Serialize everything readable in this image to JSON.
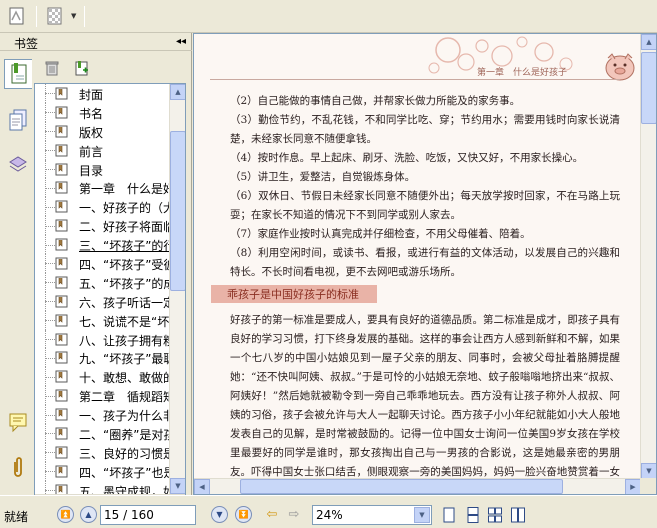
{
  "sidebar": {
    "title": "书签",
    "collapse_glyph": "◂◂",
    "bookmarks": [
      {
        "label": "封面"
      },
      {
        "label": "书名"
      },
      {
        "label": "版权"
      },
      {
        "label": "前言"
      },
      {
        "label": "目录"
      },
      {
        "label": "第一章　什么是好"
      },
      {
        "label": "一、好孩子的（大"
      },
      {
        "label": "二、好孩子将面临"
      },
      {
        "label": "三、“坏孩子”的行"
      },
      {
        "label": "四、“坏孩子”受彼"
      },
      {
        "label": "五、“坏孩子”的成"
      },
      {
        "label": "六、孩子听话一定"
      },
      {
        "label": "七、说谎不是“坏"
      },
      {
        "label": "八、让孩子拥有糗"
      },
      {
        "label": "九、“坏孩子”最聪"
      },
      {
        "label": "十、敢想、敢做的"
      },
      {
        "label": "第二章　循规蹈矩"
      },
      {
        "label": "一、孩子为什么非"
      },
      {
        "label": "二、“圈养”是对孩"
      },
      {
        "label": "三、良好的习惯是"
      },
      {
        "label": "四、“坏孩子”也是"
      },
      {
        "label": "五、墨守成规，如"
      }
    ],
    "selected_index": 8,
    "scroll_position": 0.14
  },
  "document": {
    "header_text": "第一章　什么是好孩子",
    "paragraphs": [
      "（2）自己能做的事情自己做，并帮家长做力所能及的家务事。",
      "（3）勤俭节约，不乱花钱，不和同学比吃、穿；节约用水；需要用钱时向家长说清楚，未经家长同意不随便拿钱。",
      "（4）按时作息。早上起床、刷牙、洗脸、吃饭，又快又好，不用家长操心。",
      "（5）讲卫生，爱整洁，自觉锻炼身体。",
      "（6）双休日、节假日未经家长同意不随便外出；每天放学按时回家，不在马路上玩耍；在家长不知道的情况下不到同学或别人家去。",
      "（7）家庭作业按时认真完成并仔细检查，不用父母催着、陪着。",
      "（8）利用空闲时间，或读书、看报，或进行有益的文体活动，以发展自己的兴趣和特长。不长时间看电视，更不去网吧或游乐场所。"
    ],
    "section_title": "乖孩子是中国好孩子的标准",
    "body": "好孩子的第一标准是要成人，要具有良好的道德品质。第二标准是成才，即孩子具有良好的学习习惯，打下终身发展的基础。这样的事会让西方人感到新鲜和不解，如果一个七八岁的中国小姑娘见到一屋子父亲的朋友、同事时，会被父母扯着胳膊提醒她：“还不快叫阿姨、叔叔。”于是可怜的小姑娘无奈地、蚊子般嗡嗡地挤出来“叔叔、阿姨好！”然后她就被勒令到一旁自己乖乖地玩去。西方没有让孩子称外人叔叔、阿姨的习俗，孩子会被允许与大人一起聊天讨论。西方孩子小小年纪就能如小大人般地发表自己的见解，是时常被鼓励的。记得一位中国女士询问一位美国9岁女孩在学校里最要好的同学是谁时，那女孩掏出自己与一男孩的合影说，这是她最亲密的男朋友。吓得中国女士张口结舌，侧眼观察一旁的美国妈妈，妈妈一脸兴奋地赞赏着一女儿的女孩子在学校有人喜欢，像是（笑像）"
  },
  "statusbar": {
    "status": "就绪",
    "page_indicator": "15 / 160",
    "zoom": "24%",
    "current_page": 15,
    "total_pages": 160
  },
  "colors": {
    "chrome": "#ece9d8",
    "page_bg": "#fcf7f3",
    "accent": "#e9b3a7",
    "scroll": "#c4d3f7"
  }
}
